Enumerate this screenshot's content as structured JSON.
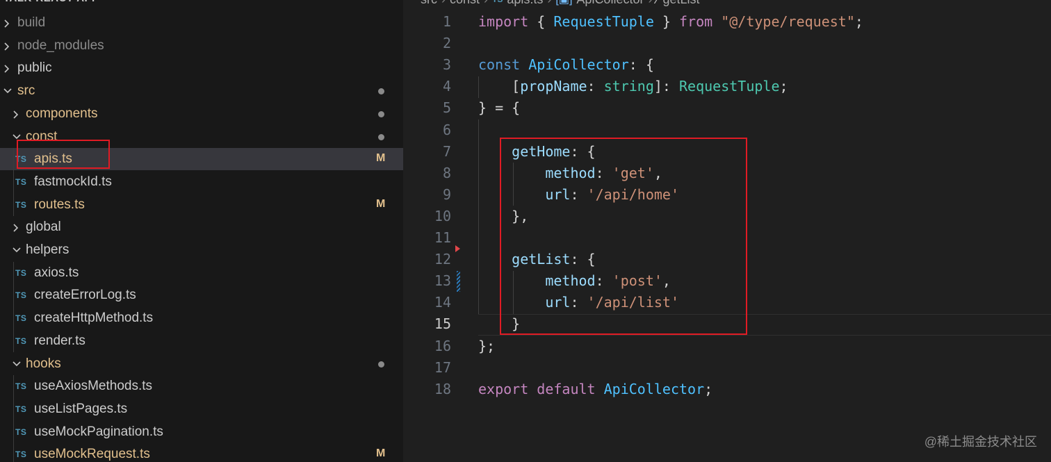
{
  "sidebar": {
    "title": "TALK-REACT-APP",
    "items": [
      {
        "label": "build",
        "kind": "folder",
        "state": "collapsed",
        "depth": 0,
        "dim": true
      },
      {
        "label": "node_modules",
        "kind": "folder",
        "state": "collapsed",
        "depth": 0,
        "dim": true
      },
      {
        "label": "public",
        "kind": "folder",
        "state": "collapsed",
        "depth": 0
      },
      {
        "label": "src",
        "kind": "folder",
        "state": "expanded",
        "depth": 0,
        "modified": true,
        "dot": true
      },
      {
        "label": "components",
        "kind": "folder",
        "state": "collapsed",
        "depth": 1,
        "modified": true,
        "dot": true
      },
      {
        "label": "const",
        "kind": "folder",
        "state": "expanded",
        "depth": 1,
        "modified": true,
        "dot": true
      },
      {
        "label": "apis.ts",
        "kind": "file",
        "badge": "TS",
        "depth": 2,
        "modified": true,
        "status": "M",
        "selected": true
      },
      {
        "label": "fastmockId.ts",
        "kind": "file",
        "badge": "TS",
        "depth": 2
      },
      {
        "label": "routes.ts",
        "kind": "file",
        "badge": "TS",
        "depth": 2,
        "modified": true,
        "status": "M"
      },
      {
        "label": "global",
        "kind": "folder",
        "state": "collapsed",
        "depth": 1
      },
      {
        "label": "helpers",
        "kind": "folder",
        "state": "expanded",
        "depth": 1
      },
      {
        "label": "axios.ts",
        "kind": "file",
        "badge": "TS",
        "depth": 2
      },
      {
        "label": "createErrorLog.ts",
        "kind": "file",
        "badge": "TS",
        "depth": 2
      },
      {
        "label": "createHttpMethod.ts",
        "kind": "file",
        "badge": "TS",
        "depth": 2
      },
      {
        "label": "render.ts",
        "kind": "file",
        "badge": "TS",
        "depth": 2
      },
      {
        "label": "hooks",
        "kind": "folder",
        "state": "expanded",
        "depth": 1,
        "modified": true,
        "dot": true
      },
      {
        "label": "useAxiosMethods.ts",
        "kind": "file",
        "badge": "TS",
        "depth": 2
      },
      {
        "label": "useListPages.ts",
        "kind": "file",
        "badge": "TS",
        "depth": 2
      },
      {
        "label": "useMockPagination.ts",
        "kind": "file",
        "badge": "TS",
        "depth": 2
      },
      {
        "label": "useMockRequest.ts",
        "kind": "file",
        "badge": "TS",
        "depth": 2,
        "modified": true,
        "status": "M"
      }
    ]
  },
  "breadcrumb": {
    "parts": [
      "src",
      "const",
      "apis.ts",
      "ApiCollector",
      "getList"
    ],
    "file_badge": "TS"
  },
  "editor": {
    "current_line": 15,
    "lines": [
      {
        "n": "1",
        "tokens": [
          [
            "kw",
            "import"
          ],
          [
            "p",
            " { "
          ],
          [
            "var",
            "RequestTuple"
          ],
          [
            "p",
            " } "
          ],
          [
            "kw",
            "from"
          ],
          [
            "p",
            " "
          ],
          [
            "str",
            "\"@/type/request\""
          ],
          [
            "p",
            ";"
          ]
        ]
      },
      {
        "n": "2",
        "tokens": []
      },
      {
        "n": "3",
        "tokens": [
          [
            "st",
            "const"
          ],
          [
            "p",
            " "
          ],
          [
            "var",
            "ApiCollector"
          ],
          [
            "p",
            ": {"
          ]
        ]
      },
      {
        "n": "4",
        "tokens": [
          [
            "p",
            "    ["
          ],
          [
            "prop",
            "propName"
          ],
          [
            "p",
            ": "
          ],
          [
            "ty",
            "string"
          ],
          [
            "p",
            "]: "
          ],
          [
            "ty",
            "RequestTuple"
          ],
          [
            "p",
            ";"
          ]
        ]
      },
      {
        "n": "5",
        "tokens": [
          [
            "p",
            "} = {"
          ]
        ]
      },
      {
        "n": "6",
        "tokens": []
      },
      {
        "n": "7",
        "tokens": [
          [
            "p",
            "    "
          ],
          [
            "prop",
            "getHome"
          ],
          [
            "p",
            ": {"
          ]
        ]
      },
      {
        "n": "8",
        "tokens": [
          [
            "p",
            "        "
          ],
          [
            "prop",
            "method"
          ],
          [
            "p",
            ": "
          ],
          [
            "str",
            "'get'"
          ],
          [
            "p",
            ","
          ]
        ]
      },
      {
        "n": "9",
        "tokens": [
          [
            "p",
            "        "
          ],
          [
            "prop",
            "url"
          ],
          [
            "p",
            ": "
          ],
          [
            "str",
            "'/api/home'"
          ]
        ]
      },
      {
        "n": "10",
        "tokens": [
          [
            "p",
            "    },"
          ]
        ]
      },
      {
        "n": "11",
        "tokens": []
      },
      {
        "n": "12",
        "tokens": [
          [
            "p",
            "    "
          ],
          [
            "prop",
            "getList"
          ],
          [
            "p",
            ": {"
          ]
        ]
      },
      {
        "n": "13",
        "tokens": [
          [
            "p",
            "        "
          ],
          [
            "prop",
            "method"
          ],
          [
            "p",
            ": "
          ],
          [
            "str",
            "'post'"
          ],
          [
            "p",
            ","
          ]
        ]
      },
      {
        "n": "14",
        "tokens": [
          [
            "p",
            "        "
          ],
          [
            "prop",
            "url"
          ],
          [
            "p",
            ": "
          ],
          [
            "str",
            "'/api/list'"
          ]
        ]
      },
      {
        "n": "15",
        "tokens": [
          [
            "p",
            "    }"
          ]
        ]
      },
      {
        "n": "16",
        "tokens": [
          [
            "p",
            "};"
          ]
        ]
      },
      {
        "n": "17",
        "tokens": []
      },
      {
        "n": "18",
        "tokens": [
          [
            "kw",
            "export"
          ],
          [
            "p",
            " "
          ],
          [
            "kw",
            "default"
          ],
          [
            "p",
            " "
          ],
          [
            "var",
            "ApiCollector"
          ],
          [
            "p",
            ";"
          ]
        ]
      }
    ]
  },
  "watermark": "@稀土掘金技术社区",
  "colors": {
    "sidebar_bg": "#181818",
    "editor_bg": "#1f1f1f",
    "highlight_border": "#e01b24",
    "modified": "#e2c08d",
    "ts_badge": "#519aba"
  }
}
